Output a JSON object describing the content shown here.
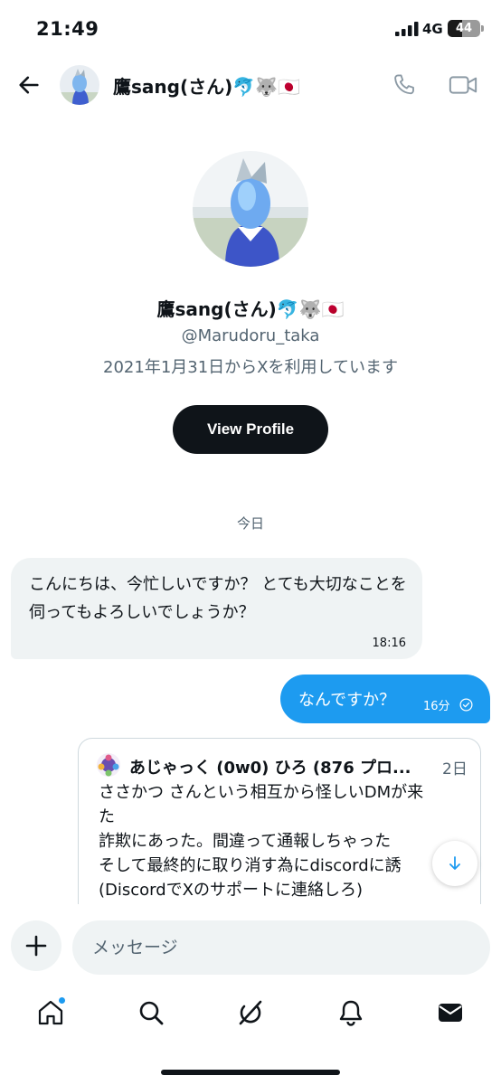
{
  "status_bar": {
    "time": "21:49",
    "network": "4G",
    "battery_level": "44",
    "battery_fraction": 0.44
  },
  "header": {
    "back_icon": "arrow-left-icon",
    "name": "鷹sang(さん)🐬🐺🇯🇵",
    "call_icon": "phone-icon",
    "video_icon": "video-camera-icon"
  },
  "profile": {
    "name": "鷹sang(さん)🐬🐺🇯🇵",
    "handle": "@Marudoru_taka",
    "joined": "2021年1月31日からXを利用しています",
    "view_profile_label": "View Profile"
  },
  "conversation": {
    "date_separator": "今日",
    "messages": [
      {
        "direction": "incoming",
        "text": "こんにちは、今忙しいですか？ とても大切なことを伺ってもよろしいでしょうか？",
        "time": "18:16"
      },
      {
        "direction": "outgoing",
        "text": "なんですか？",
        "time": "16分",
        "status_icon": "seen-check-icon"
      }
    ],
    "quoted_post": {
      "author": "あじゃっく (0w0) ひろ (876 プロ...",
      "age": "2日",
      "lines": [
        "ささかつ さんという相互から怪しいDMが来",
        "た",
        "詐欺にあった。間違って通報しちゃった",
        "そして最終的に取り消す為にdiscordに誘",
        "(DiscordでXのサポートに連絡しろ)"
      ]
    }
  },
  "composer": {
    "add_icon": "plus-icon",
    "placeholder": "メッセージ"
  },
  "tab_bar": {
    "tabs": [
      "home-icon",
      "search-icon",
      "grok-icon",
      "notifications-icon",
      "messages-icon"
    ]
  },
  "colors": {
    "accent": "#1d9bf0",
    "text_primary": "#0f1419",
    "text_secondary": "#536471",
    "bubble_incoming": "#eff3f4"
  }
}
